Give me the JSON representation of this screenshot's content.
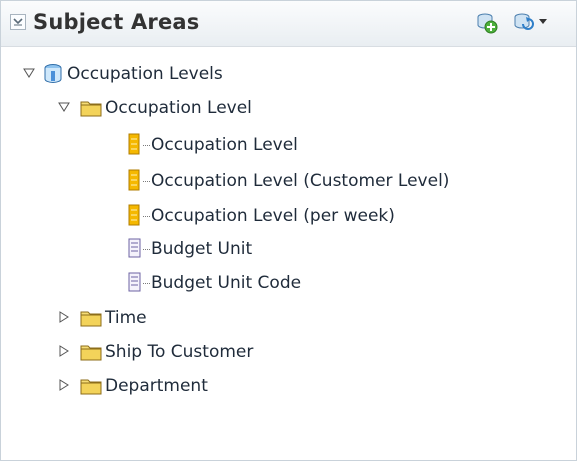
{
  "header": {
    "title": "Subject Areas"
  },
  "icons": {
    "collapse": "chevron-down-icon",
    "add_subject_area": "add-subject-area-icon",
    "refresh": "refresh-icon",
    "menu": "dropdown-arrow-icon"
  },
  "tree": {
    "root": {
      "label": "Occupation Levels",
      "expanded": true
    },
    "folders": [
      {
        "label": "Occupation Level",
        "expanded": true,
        "items": [
          {
            "label": "Occupation Level",
            "type": "hierarchy-column"
          },
          {
            "label": "Occupation Level (Customer Level)",
            "type": "hierarchy-column"
          },
          {
            "label": "Occupation Level (per week)",
            "type": "hierarchy-column"
          },
          {
            "label": "Budget Unit",
            "type": "attribute-column"
          },
          {
            "label": "Budget Unit Code",
            "type": "attribute-column"
          }
        ]
      },
      {
        "label": "Time",
        "expanded": false
      },
      {
        "label": "Ship To Customer",
        "expanded": false
      },
      {
        "label": "Department",
        "expanded": false
      }
    ]
  },
  "colors": {
    "header_bg": "#eef2f5",
    "folder": "#f3d35a",
    "hierarchy_icon": "#f5b800",
    "attribute_icon": "#8a7fb8",
    "text": "#1f2b3a"
  }
}
